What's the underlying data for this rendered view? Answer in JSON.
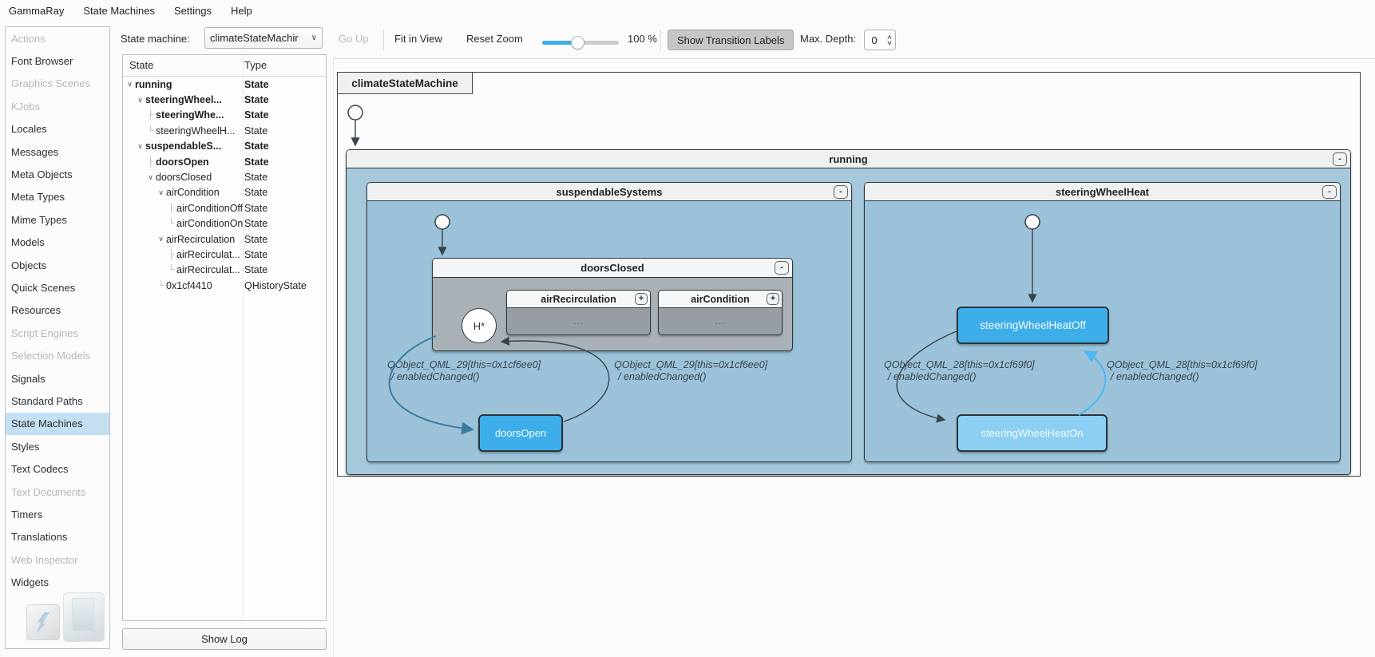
{
  "menu": {
    "items": [
      "GammaRay",
      "State Machines",
      "Settings",
      "Help"
    ]
  },
  "sidebar": {
    "items": [
      {
        "label": "Actions",
        "enabled": false
      },
      {
        "label": "Font Browser",
        "enabled": true
      },
      {
        "label": "Graphics Scenes",
        "enabled": false
      },
      {
        "label": "KJobs",
        "enabled": false
      },
      {
        "label": "Locales",
        "enabled": true
      },
      {
        "label": "Messages",
        "enabled": true
      },
      {
        "label": "Meta Objects",
        "enabled": true
      },
      {
        "label": "Meta Types",
        "enabled": true
      },
      {
        "label": "Mime Types",
        "enabled": true
      },
      {
        "label": "Models",
        "enabled": true
      },
      {
        "label": "Objects",
        "enabled": true
      },
      {
        "label": "Quick Scenes",
        "enabled": true
      },
      {
        "label": "Resources",
        "enabled": true
      },
      {
        "label": "Script Engines",
        "enabled": false
      },
      {
        "label": "Selection Models",
        "enabled": false
      },
      {
        "label": "Signals",
        "enabled": true
      },
      {
        "label": "Standard Paths",
        "enabled": true
      },
      {
        "label": "State Machines",
        "enabled": true,
        "selected": true
      },
      {
        "label": "Styles",
        "enabled": true
      },
      {
        "label": "Text Codecs",
        "enabled": true
      },
      {
        "label": "Text Documents",
        "enabled": false
      },
      {
        "label": "Timers",
        "enabled": true
      },
      {
        "label": "Translations",
        "enabled": true
      },
      {
        "label": "Web Inspector",
        "enabled": false
      },
      {
        "label": "Widgets",
        "enabled": true
      }
    ]
  },
  "toolbar": {
    "state_machine_label": "State machine:",
    "combo_value": "climateStateMachir",
    "combo_chevron": "∨",
    "go_up": "Go Up",
    "fit_in_view": "Fit in View",
    "reset_zoom": "Reset Zoom",
    "zoom_value": "100 %",
    "show_transition_labels": "Show Transition Labels",
    "max_depth_label": "Max. Depth:",
    "max_depth_value": "0",
    "spin_up": "∧",
    "spin_down": "∨"
  },
  "tree": {
    "columns": [
      "State",
      "Type"
    ],
    "rows": [
      {
        "state": "running",
        "type": "State"
      },
      {
        "state": "steeringWheel...",
        "type": "State"
      },
      {
        "state": "steeringWhe...",
        "type": "State"
      },
      {
        "state": "steeringWheelH...",
        "type": "State"
      },
      {
        "state": "suspendableS...",
        "type": "State"
      },
      {
        "state": "doorsOpen",
        "type": "State"
      },
      {
        "state": "doorsClosed",
        "type": "State"
      },
      {
        "state": "airCondition",
        "type": "State"
      },
      {
        "state": "airConditionOff",
        "type": "State"
      },
      {
        "state": "airConditionOn",
        "type": "State"
      },
      {
        "state": "airRecirculation",
        "type": "State"
      },
      {
        "state": "airRecirculat...",
        "type": "State"
      },
      {
        "state": "airRecirculat...",
        "type": "State"
      },
      {
        "state": "0x1cf4410",
        "type": "QHistoryState"
      }
    ]
  },
  "show_log_label": "Show Log",
  "diagram": {
    "machine_title": "climateStateMachine",
    "running_title": "running",
    "suspendable_title": "suspendableSystems",
    "steering_title": "steeringWheelHeat",
    "doors_closed_title": "doorsClosed",
    "air_recirculation_title": "airRecirculation",
    "air_condition_title": "airCondition",
    "ellipsis": "...",
    "collapse_label": "-",
    "expand_label": "+",
    "history_label": "H*",
    "doors_open": "doorsOpen",
    "wheel_off": "steeringWheelHeatOff",
    "wheel_on": "steeringWheelHeatOn",
    "transition_labels": [
      {
        "line1": "QObject_QML_29[this=0x1cf6ee0]",
        "line2": "/ enabledChanged()"
      },
      {
        "line1": "QObject_QML_29[this=0x1cf6ee0]",
        "line2": "/ enabledChanged()"
      },
      {
        "line1": "QObject_QML_28[this=0x1cf69f0]",
        "line2": "/ enabledChanged()"
      },
      {
        "line1": "QObject_QML_28[this=0x1cf69f0]",
        "line2": "/ enabledChanged()"
      }
    ],
    "colors": {
      "active_state": "#3daee9",
      "recent_state": "#8dcff2",
      "running_bg": "#a6c8db",
      "region_bg": "#9bc2d8",
      "composite_gray": "#a9b0b6",
      "collapsed_gray": "#979da3",
      "transition_active": "#3c7b9e",
      "transition_recent": "#4cb7f0",
      "transition_dark": "#39434b",
      "sidebar_selection": "#c4def2"
    }
  }
}
